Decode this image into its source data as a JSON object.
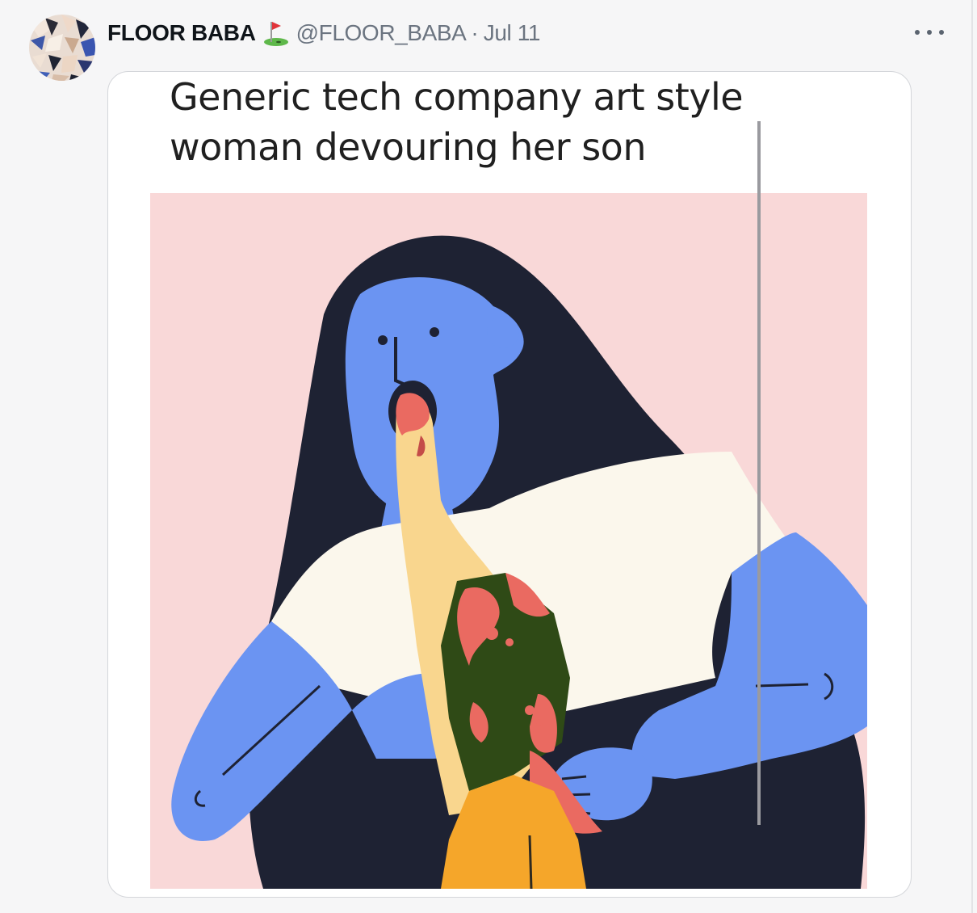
{
  "tweet": {
    "author": {
      "display_name": "FLOOR BABA",
      "name_emoji": "golf-flag-icon",
      "handle": "@FLOOR_BABA",
      "separator": "·",
      "date": "Jul 11"
    },
    "more_options_icon": "more-horizontal-icon",
    "media": {
      "caption_line_1": "Generic tech company art style",
      "caption_line_2": "woman devouring her son",
      "colors": {
        "background": "#f9d8d8",
        "hair": "#1e2233",
        "skin": "#6b94f2",
        "shirt": "#fbf7ec",
        "child_skin": "#f9d68e",
        "child_top": "#2f4a16",
        "blood": "#ea6a61",
        "pants": "#f5a62a"
      }
    }
  }
}
